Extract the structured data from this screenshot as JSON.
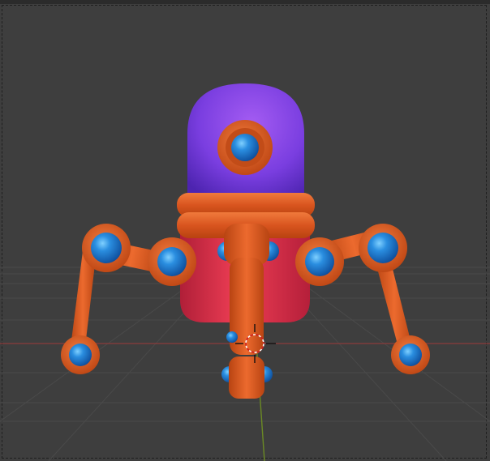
{
  "app": {
    "view": "3D Viewport"
  },
  "colors": {
    "background": "#3e3e3e",
    "grid_line": "#4a4a4a",
    "x_axis": "#8a3a3a",
    "y_axis": "#6e8a2a",
    "dome": "#7b3fe0",
    "body": "#e0344a",
    "limbs": "#e0602a",
    "joints": "#1e7fd0"
  },
  "objects": {
    "robot": "robot-model",
    "cursor": "3d-cursor-icon"
  }
}
